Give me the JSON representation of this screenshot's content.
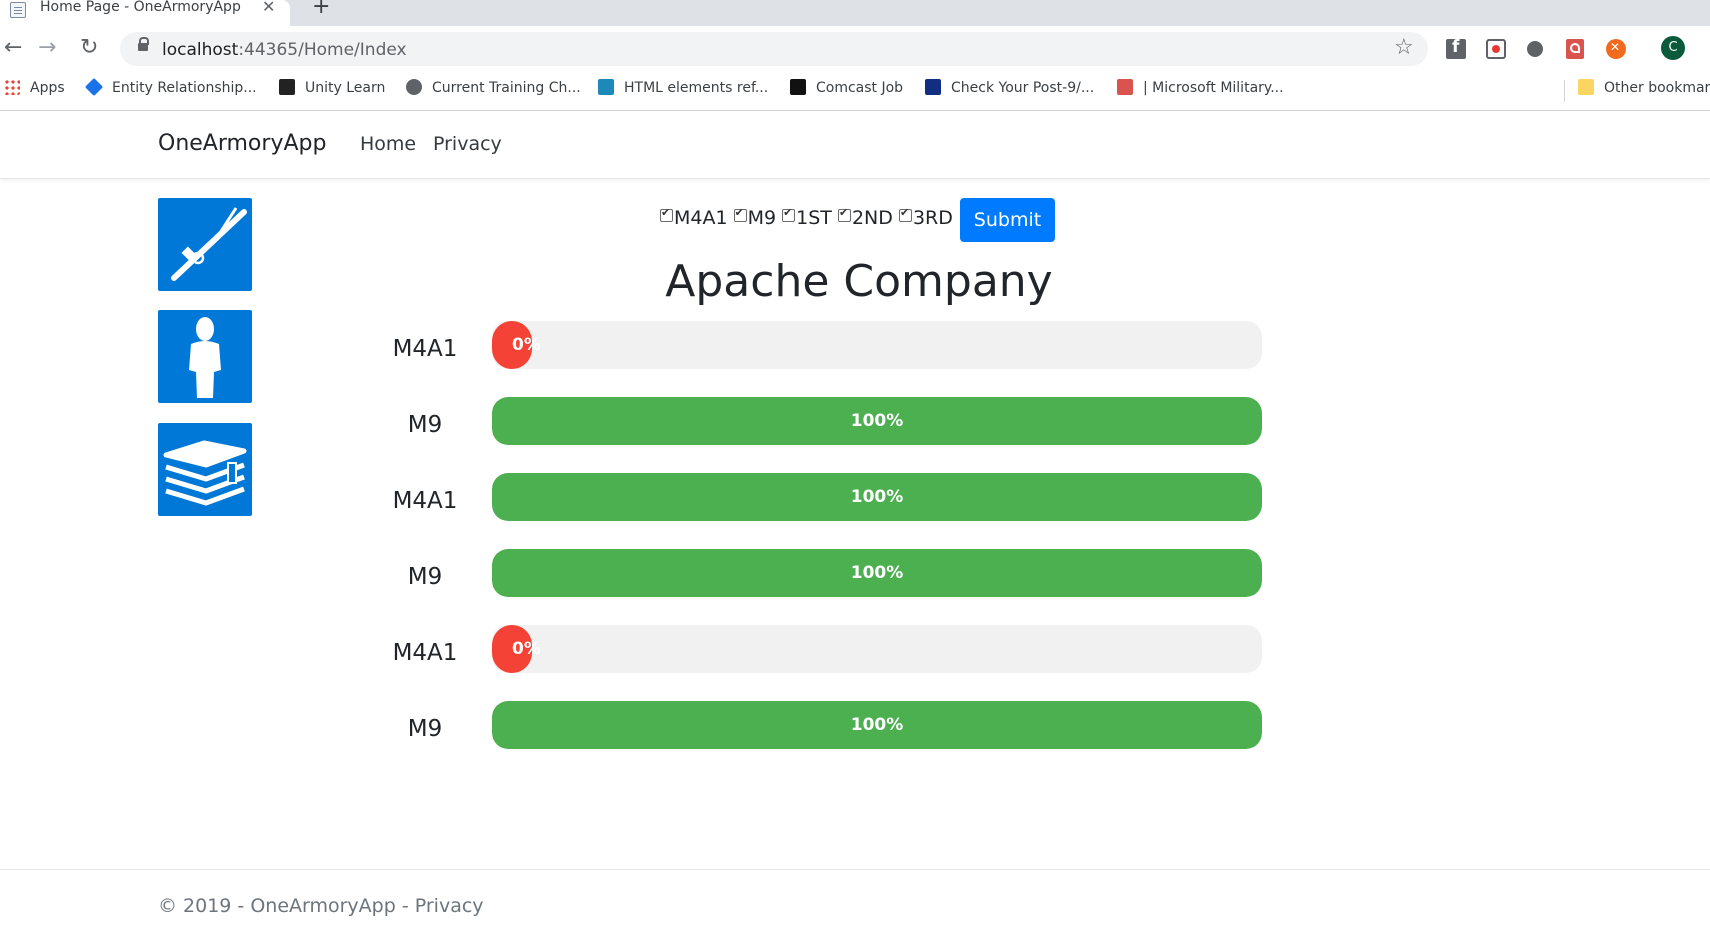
{
  "browser": {
    "tab_title": "Home Page - OneArmoryApp",
    "url_host": "localhost",
    "url_rest": ":44365/Home/Index",
    "profile_initial": "C",
    "bookmarks": [
      {
        "label": "Apps",
        "icon": "apps-grid-icon"
      },
      {
        "label": "Entity Relationship...",
        "icon": "diamond-icon"
      },
      {
        "label": "Unity Learn",
        "icon": "unity-icon"
      },
      {
        "label": "Current Training Ch...",
        "icon": "globe-icon"
      },
      {
        "label": "HTML elements ref...",
        "icon": "html-icon"
      },
      {
        "label": "Comcast Job",
        "icon": "c-logo-icon"
      },
      {
        "label": "Check Your Post-9/...",
        "icon": "va-logo-icon"
      },
      {
        "label": "| Microsoft Military...",
        "icon": "edx-logo-icon"
      },
      {
        "label": "Other bookmarks",
        "icon": "folder-icon"
      }
    ]
  },
  "navbar": {
    "brand": "OneArmoryApp",
    "links": [
      "Home",
      "Privacy"
    ]
  },
  "side_tiles": [
    "rifle-icon",
    "person-icon",
    "books-icon"
  ],
  "filters": {
    "options": [
      {
        "label": "M4A1",
        "checked": true
      },
      {
        "label": "M9",
        "checked": true
      },
      {
        "label": "1ST",
        "checked": true
      },
      {
        "label": "2ND",
        "checked": true
      },
      {
        "label": "3RD",
        "checked": true
      }
    ],
    "submit_label": "Submit"
  },
  "company_title": "Apache Company",
  "rows": [
    {
      "label": "M4A1",
      "percent": 0,
      "text": "0%"
    },
    {
      "label": "M9",
      "percent": 100,
      "text": "100%"
    },
    {
      "label": "M4A1",
      "percent": 100,
      "text": "100%"
    },
    {
      "label": "M9",
      "percent": 100,
      "text": "100%"
    },
    {
      "label": "M4A1",
      "percent": 0,
      "text": "0%"
    },
    {
      "label": "M9",
      "percent": 100,
      "text": "100%"
    }
  ],
  "footer": {
    "copyright": "© 2019 - OneArmoryApp - ",
    "privacy_link": "Privacy"
  },
  "colors": {
    "progress_full": "#4caf50",
    "progress_empty": "#f44336",
    "tile_blue": "#0078d7",
    "submit_blue": "#007bff"
  }
}
